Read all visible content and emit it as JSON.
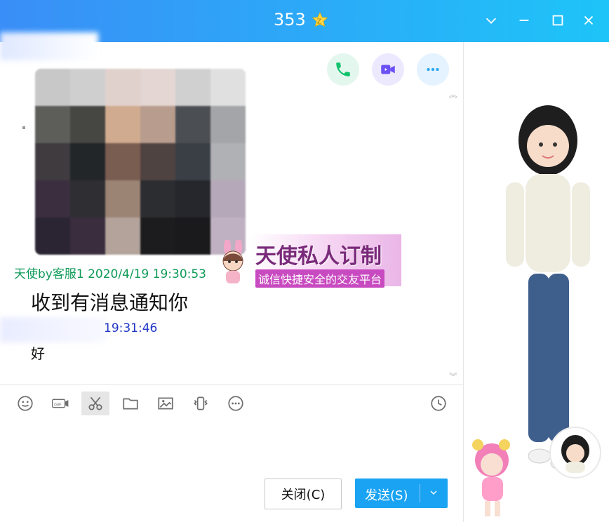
{
  "window": {
    "title": "353",
    "badge_icon": "star-z-icon",
    "controls": [
      "chevron-down-icon",
      "minimize-icon",
      "maximize-icon",
      "close-icon"
    ]
  },
  "header_actions": {
    "call_icon": "phone-icon",
    "video_icon": "video-call-icon",
    "more_icon": "more-icon"
  },
  "banner": {
    "title": "天使私人订制",
    "subtitle": "诚信快捷安全的交友平台"
  },
  "messages": [
    {
      "sender_time": "天使by客服1 2020/4/19 19:30:53",
      "text": "收到有消息通知你"
    },
    {
      "sender_time": "19:31:46",
      "text": "好"
    }
  ],
  "toolbar": {
    "items": [
      "emoji-icon",
      "gif-icon",
      "scissors-icon",
      "folder-icon",
      "image-icon",
      "vibrate-icon",
      "more-icon",
      "clock-icon"
    ]
  },
  "buttons": {
    "close_label": "关闭(C)",
    "send_label": "发送(S)"
  },
  "colors": {
    "title_gradient_start": "#3a8ef7",
    "title_gradient_end": "#1ec4f8",
    "send_button": "#1aa3f3",
    "timestamp_sender": "#0f9a58",
    "timestamp_self": "#1f36c7"
  }
}
